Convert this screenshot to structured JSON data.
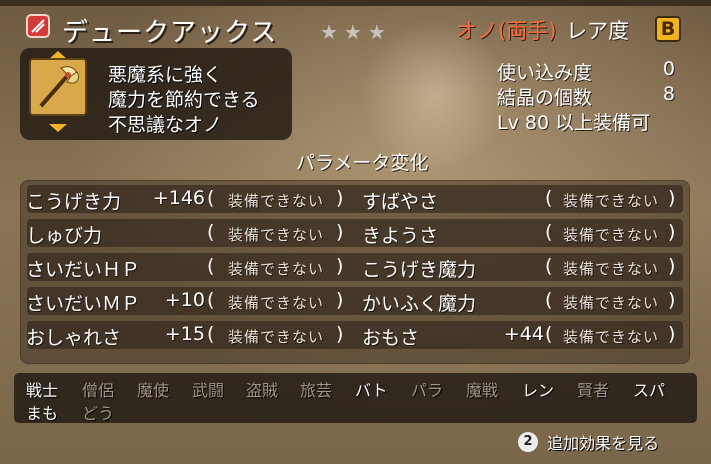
{
  "item": {
    "name": "デュークアックス",
    "stars": "★★★",
    "weapon_type": "オノ(両手)",
    "rarity_label": "レア度",
    "rarity": "B",
    "description": [
      "悪魔系に強く",
      "魔力を節約できる",
      "不思議なオノ"
    ]
  },
  "stats": {
    "usage_label": "使い込み度",
    "usage_value": "0",
    "crystal_label": "結晶の個数",
    "crystal_value": "8",
    "level_text": "Lv 80 以上装備可"
  },
  "params": {
    "title": "パラメータ変化",
    "left": [
      {
        "label": "こうげき力",
        "value": "+146",
        "status": "装備できない"
      },
      {
        "label": "しゅび力",
        "value": "",
        "status": "装備できない"
      },
      {
        "label": "さいだいＨＰ",
        "value": "",
        "status": "装備できない"
      },
      {
        "label": "さいだいＭＰ",
        "value": "+10",
        "status": "装備できない"
      },
      {
        "label": "おしゃれさ",
        "value": "+15",
        "status": "装備できない"
      }
    ],
    "right": [
      {
        "label": "すばやさ",
        "value": "",
        "status": "装備できない"
      },
      {
        "label": "きようさ",
        "value": "",
        "status": "装備できない"
      },
      {
        "label": "こうげき魔力",
        "value": "",
        "status": "装備できない"
      },
      {
        "label": "かいふく魔力",
        "value": "",
        "status": "装備できない"
      },
      {
        "label": "おもさ",
        "value": "+44",
        "status": "装備できない"
      }
    ]
  },
  "jobs": {
    "row1": [
      {
        "label": "戦士",
        "active": true
      },
      {
        "label": "僧侶",
        "active": false
      },
      {
        "label": "魔使",
        "active": false
      },
      {
        "label": "武闘",
        "active": false
      },
      {
        "label": "盗賊",
        "active": false
      },
      {
        "label": "旅芸",
        "active": false
      },
      {
        "label": "バト",
        "active": true
      },
      {
        "label": "パラ",
        "active": false
      },
      {
        "label": "魔戦",
        "active": false
      },
      {
        "label": "レン",
        "active": true
      },
      {
        "label": "賢者",
        "active": false
      },
      {
        "label": "スパ",
        "active": true
      }
    ],
    "row2": [
      {
        "label": "まも",
        "active": true
      },
      {
        "label": "どう",
        "active": false
      }
    ]
  },
  "footer": {
    "button_number": "2",
    "label": "追加効果を見る"
  },
  "colors": {
    "weapon_type": "#ff6a3d",
    "rarity_badge": "#f0b21e",
    "title_icon": "#d53a3a",
    "job_active": "#ffffff",
    "job_inactive": "#a39685"
  },
  "icons": {
    "title_icon": "weapon-category-icon",
    "item_icon": "axe-icon"
  }
}
